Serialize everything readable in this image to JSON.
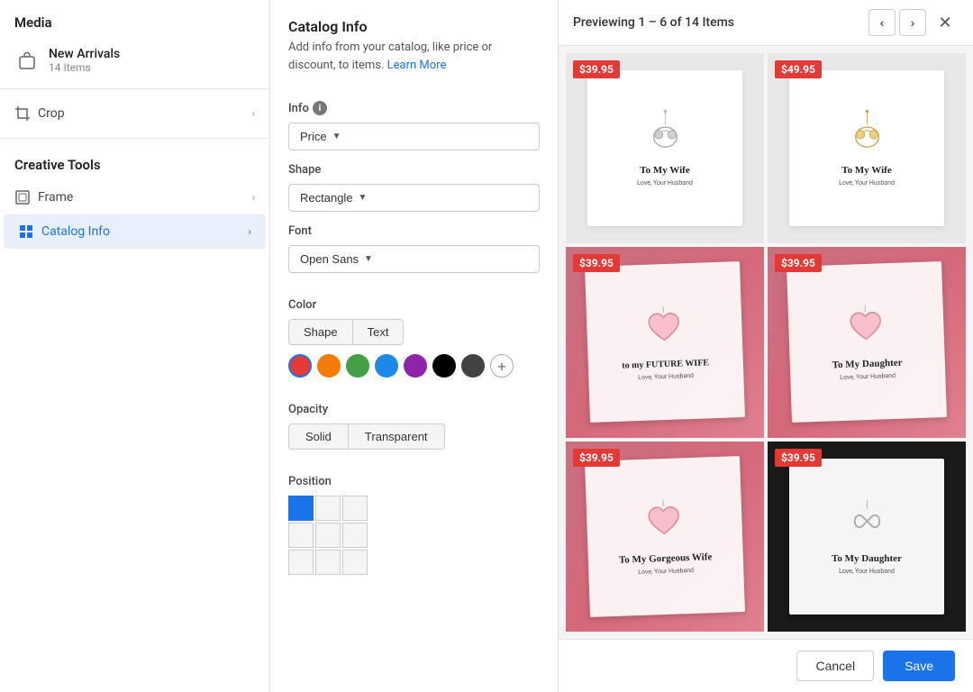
{
  "sidebar": {
    "media_title": "Media",
    "new_arrivals_label": "New Arrivals",
    "new_arrivals_count": "14 Items",
    "crop_label": "Crop",
    "creative_tools_title": "Creative Tools",
    "frame_label": "Frame",
    "catalog_info_label": "Catalog Info"
  },
  "middle_panel": {
    "title": "Catalog Info",
    "subtitle": "Add info from your catalog, like price or discount, to items.",
    "learn_more": "Learn More",
    "info_label": "Info",
    "info_value": "Price",
    "shape_label": "Shape",
    "shape_value": "Rectangle",
    "font_label": "Font",
    "font_value": "Open Sans",
    "color_label": "Color",
    "color_tab_shape": "Shape",
    "color_tab_text": "Text",
    "colors": [
      "#e53935",
      "#f57c00",
      "#43a047",
      "#1e88e5",
      "#8e24aa",
      "#000000",
      "#424242"
    ],
    "opacity_label": "Opacity",
    "opacity_solid": "Solid",
    "opacity_transparent": "Transparent",
    "position_label": "Position"
  },
  "preview": {
    "title": "Previewing 1 – 6 of 14 Items",
    "items": [
      {
        "price": "$39.95",
        "bg": "white",
        "title": "To My Wife"
      },
      {
        "price": "$49.95",
        "bg": "white",
        "title": "To My Wife"
      },
      {
        "price": "$39.95",
        "bg": "rose",
        "title": "to my FUTURE WIFE"
      },
      {
        "price": "$39.95",
        "bg": "rose",
        "title": "To My Daughter"
      },
      {
        "price": "$39.95",
        "bg": "rose",
        "title": "To My Gorgeous Wife"
      },
      {
        "price": "$39.95",
        "bg": "dark",
        "title": "To My Daughter"
      }
    ]
  },
  "footer": {
    "cancel_label": "Cancel",
    "save_label": "Save"
  },
  "position_grid": {
    "active_cell": 0
  }
}
